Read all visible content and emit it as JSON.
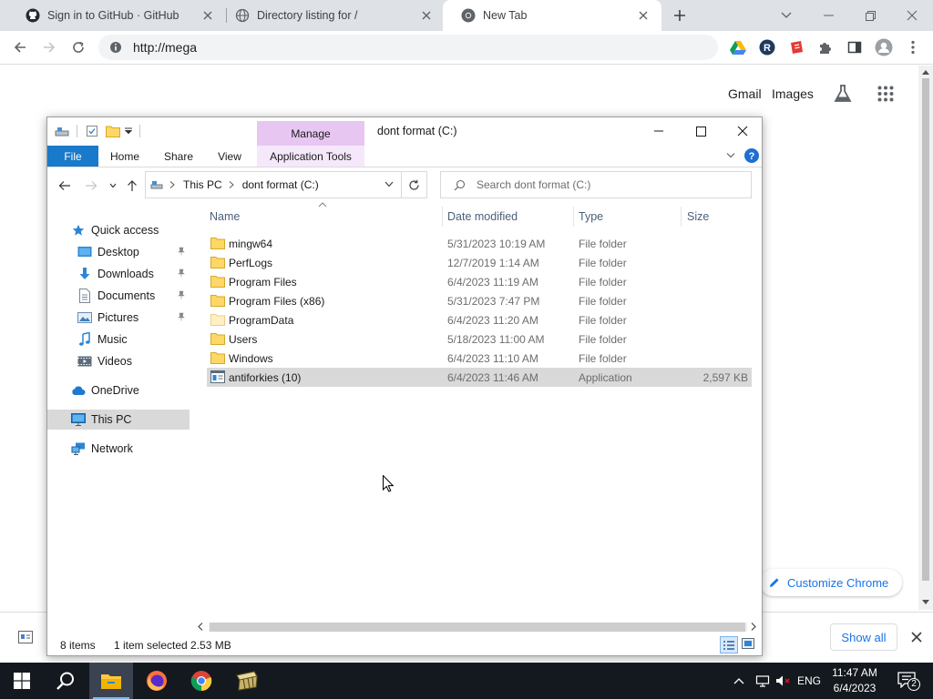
{
  "browser": {
    "tabs": [
      {
        "title": "Sign in to GitHub · GitHub",
        "icon": "github-icon"
      },
      {
        "title": "Directory listing for /",
        "icon": "globe-icon"
      },
      {
        "title": "New Tab",
        "icon": "chrome-icon"
      }
    ],
    "url": "http://mega",
    "newtab": {
      "gmail": "Gmail",
      "images": "Images",
      "customize": "Customize Chrome"
    },
    "download_bar": {
      "show_all": "Show all"
    }
  },
  "explorer": {
    "title": "dont  format (C:)",
    "manage": "Manage",
    "ribbon_tabs": [
      "File",
      "Home",
      "Share",
      "View",
      "Application Tools"
    ],
    "breadcrumb": [
      "This PC",
      "dont  format (C:)"
    ],
    "search_placeholder": "Search dont  format (C:)",
    "nav": {
      "quick_access": "Quick access",
      "pinned": [
        {
          "label": "Desktop",
          "icon": "desktop-icon"
        },
        {
          "label": "Downloads",
          "icon": "downloads-icon"
        },
        {
          "label": "Documents",
          "icon": "documents-icon"
        },
        {
          "label": "Pictures",
          "icon": "pictures-icon"
        }
      ],
      "unpinned": [
        {
          "label": "Music",
          "icon": "music-icon"
        },
        {
          "label": "Videos",
          "icon": "videos-icon"
        }
      ],
      "onedrive": "OneDrive",
      "this_pc": "This PC",
      "network": "Network"
    },
    "columns": {
      "name": "Name",
      "date": "Date modified",
      "type": "Type",
      "size": "Size"
    },
    "files": [
      {
        "name": "mingw64",
        "date": "5/31/2023 10:19 AM",
        "type": "File folder",
        "size": ""
      },
      {
        "name": "PerfLogs",
        "date": "12/7/2019 1:14 AM",
        "type": "File folder",
        "size": ""
      },
      {
        "name": "Program Files",
        "date": "6/4/2023 11:19 AM",
        "type": "File folder",
        "size": ""
      },
      {
        "name": "Program Files (x86)",
        "date": "5/31/2023 7:47 PM",
        "type": "File folder",
        "size": ""
      },
      {
        "name": "ProgramData",
        "date": "6/4/2023 11:20 AM",
        "type": "File folder",
        "size": ""
      },
      {
        "name": "Users",
        "date": "5/18/2023 11:00 AM",
        "type": "File folder",
        "size": ""
      },
      {
        "name": "Windows",
        "date": "6/4/2023 11:10 AM",
        "type": "File folder",
        "size": ""
      },
      {
        "name": "antiforkies (10)",
        "date": "6/4/2023 11:46 AM",
        "type": "Application",
        "size": "2,597 KB"
      }
    ],
    "status": {
      "items": "8 items",
      "selected": "1 item selected  2.53 MB"
    }
  },
  "taskbar": {
    "lang": "ENG",
    "time": "11:47 AM",
    "date": "6/4/2023",
    "notifications": "2"
  },
  "colors": {
    "accent_blue": "#1979ca",
    "manage_band": "#e8c6f2",
    "selection": "#d9d9d9",
    "taskbar": "#14191f"
  }
}
